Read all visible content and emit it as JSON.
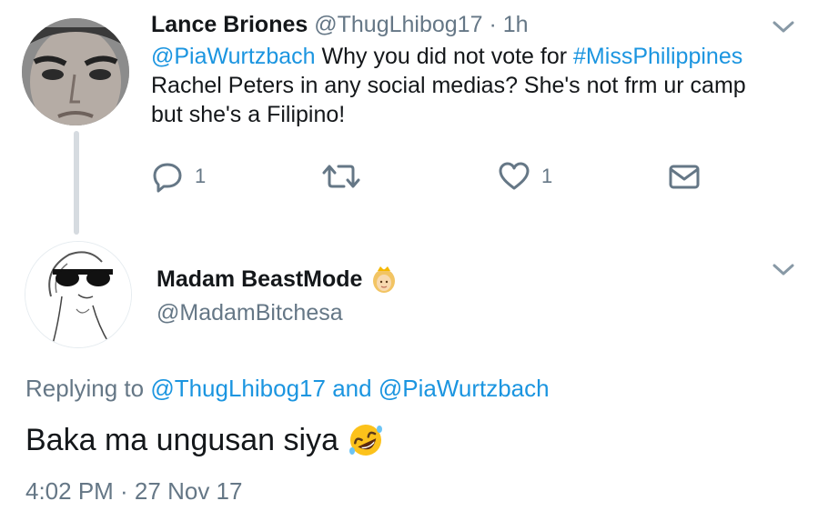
{
  "parent_tweet": {
    "author_name": "Lance Briones",
    "handle": "@ThugLhibog17",
    "separator": "·",
    "time_ago": "1h",
    "text_parts": {
      "mention": "@PiaWurtzbach",
      "part1": " Why you did not vote for ",
      "hashtag": "#MissPhilippines",
      "part2": " Rachel Peters in any social medias? She's not frm ur camp but she's a Filipino!"
    },
    "reply_count": "1",
    "like_count": "1"
  },
  "main_tweet": {
    "author_name": "Madam BeastMode",
    "handle": "@MadamBitchesa",
    "replying_prefix": "Replying to",
    "replying_user1": "@ThugLhibog17",
    "replying_and": "and",
    "replying_user2": "@PiaWurtzbach",
    "text": "Baka ma ungusan siya",
    "timestamp": "4:02 PM · 27 Nov 17"
  },
  "colors": {
    "link": "#1b95e0",
    "muted": "#657786",
    "text": "#14171a",
    "thread_line": "#d6dbe0"
  },
  "icons": [
    "reply-icon",
    "retweet-icon",
    "like-icon",
    "dm-icon",
    "chevron-down-icon",
    "princess-emoji-icon",
    "rofl-emoji-icon"
  ]
}
